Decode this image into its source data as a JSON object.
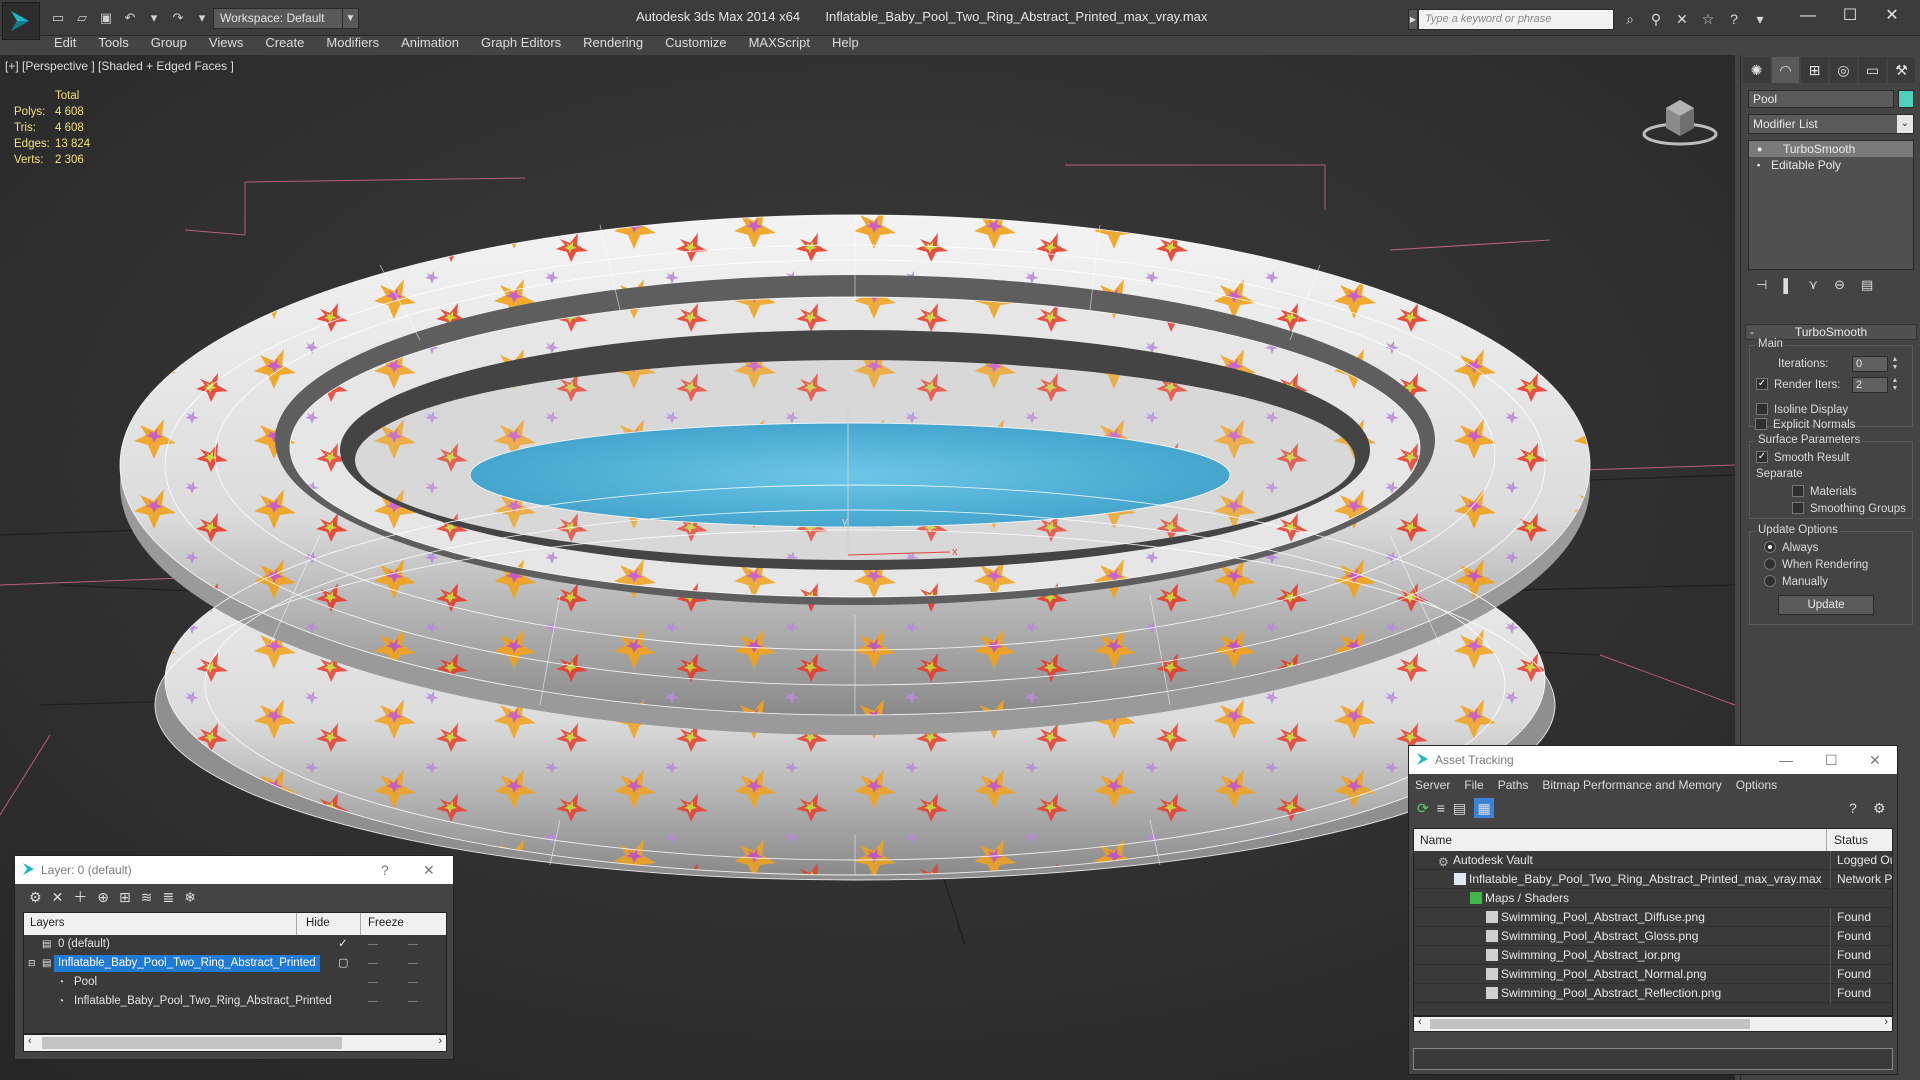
{
  "window": {
    "app_title": "Autodesk 3ds Max  2014 x64",
    "file_title": "Inflatable_Baby_Pool_Two_Ring_Abstract_Printed_max_vray.max",
    "workspace_label": "Workspace: Default",
    "search_placeholder": "Type a keyword or phrase"
  },
  "menu": [
    "Edit",
    "Tools",
    "Group",
    "Views",
    "Create",
    "Modifiers",
    "Animation",
    "Graph Editors",
    "Rendering",
    "Customize",
    "MAXScript",
    "Help"
  ],
  "viewport": {
    "label": "[+] [Perspective ] [Shaded + Edged Faces ]",
    "stats": {
      "header": "Total",
      "rows": [
        {
          "k": "Polys:",
          "v": "4 608"
        },
        {
          "k": "Tris:",
          "v": "4 608"
        },
        {
          "k": "Edges:",
          "v": "13 824"
        },
        {
          "k": "Verts:",
          "v": "2 306"
        }
      ]
    },
    "axis_x": "x",
    "axis_y": "y"
  },
  "command_panel": {
    "object_name": "Pool",
    "object_color": "#4fd1c0",
    "modifier_list": "Modifier List",
    "stack": [
      {
        "label": "TurboSmooth",
        "selected": true
      },
      {
        "label": "Editable Poly",
        "selected": false
      }
    ],
    "rollout_title": "TurboSmooth",
    "main_group": "Main",
    "iterations_label": "Iterations:",
    "iterations_value": "0",
    "render_iters_label": "Render Iters:",
    "render_iters_value": "2",
    "isoline_label": "Isoline Display",
    "explicit_normals_label": "Explicit Normals",
    "surface_group": "Surface Parameters",
    "smooth_result_label": "Smooth Result",
    "separate_label": "Separate",
    "materials_label": "Materials",
    "smoothing_groups_label": "Smoothing Groups",
    "update_group": "Update Options",
    "always_label": "Always",
    "when_rendering_label": "When Rendering",
    "manually_label": "Manually",
    "update_button": "Update"
  },
  "layer_dialog": {
    "title": "Layer: 0 (default)",
    "help": "?",
    "close": "✕",
    "col_layers": "Layers",
    "col_hide": "Hide",
    "col_freeze": "Freeze",
    "rows": [
      {
        "name": "0 (default)",
        "indent": 1,
        "selected": false
      },
      {
        "name": "Inflatable_Baby_Pool_Two_Ring_Abstract_Printed",
        "indent": 1,
        "selected": true
      },
      {
        "name": "Pool",
        "indent": 2,
        "selected": false
      },
      {
        "name": "Inflatable_Baby_Pool_Two_Ring_Abstract_Printed",
        "indent": 2,
        "selected": false
      }
    ]
  },
  "asset_dialog": {
    "title": "Asset Tracking",
    "menu": [
      "Server",
      "File",
      "Paths",
      "Bitmap Performance and Memory",
      "Options"
    ],
    "col_name": "Name",
    "col_status": "Status",
    "rows": [
      {
        "name": "Autodesk Vault",
        "status": "Logged Ou",
        "level": 1
      },
      {
        "name": "Inflatable_Baby_Pool_Two_Ring_Abstract_Printed_max_vray.max",
        "status": "Network Pa",
        "level": 2
      },
      {
        "name": "Maps / Shaders",
        "status": "",
        "level": 3
      },
      {
        "name": "Swimming_Pool_Abstract_Diffuse.png",
        "status": "Found",
        "level": 4
      },
      {
        "name": "Swimming_Pool_Abstract_Gloss.png",
        "status": "Found",
        "level": 4
      },
      {
        "name": "Swimming_Pool_Abstract_ior.png",
        "status": "Found",
        "level": 4
      },
      {
        "name": "Swimming_Pool_Abstract_Normal.png",
        "status": "Found",
        "level": 4
      },
      {
        "name": "Swimming_Pool_Abstract_Reflection.png",
        "status": "Found",
        "level": 4
      }
    ]
  }
}
